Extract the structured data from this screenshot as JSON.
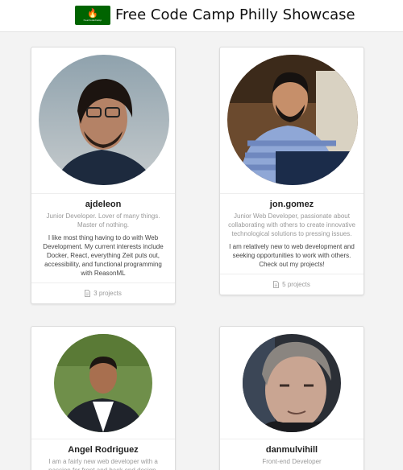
{
  "header": {
    "logo_text": "freeCodeCamp",
    "title": "Free Code Camp Philly Showcase"
  },
  "colors": {
    "brand_green": "#006400",
    "muted_text": "#9a9a9a"
  },
  "cards": [
    {
      "name": "ajdeleon",
      "tagline": "Junior Developer. Lover of many things. Master of nothing.",
      "bio": "I like most thing having to do with Web Development. My current interests include Docker, React, everything Zeit puts out, accessibility, and functional programming with ReasonML",
      "projects": "3 projects",
      "icon": "file-icon"
    },
    {
      "name": "jon.gomez",
      "tagline": "Junior Web Developer, passionate about collaborating with others to create innovative technological solutions to pressing issues.",
      "bio": "I am relatively new to web development and seeking opportunities to work with others. Check out my projects!",
      "projects": "5 projects",
      "icon": "file-icon"
    },
    {
      "name": "Angel Rodriguez",
      "tagline": "I am a fairly new web developer with a passion for front and back end design."
    },
    {
      "name": "danmulvihill",
      "tagline": "Front-end Developer"
    }
  ]
}
